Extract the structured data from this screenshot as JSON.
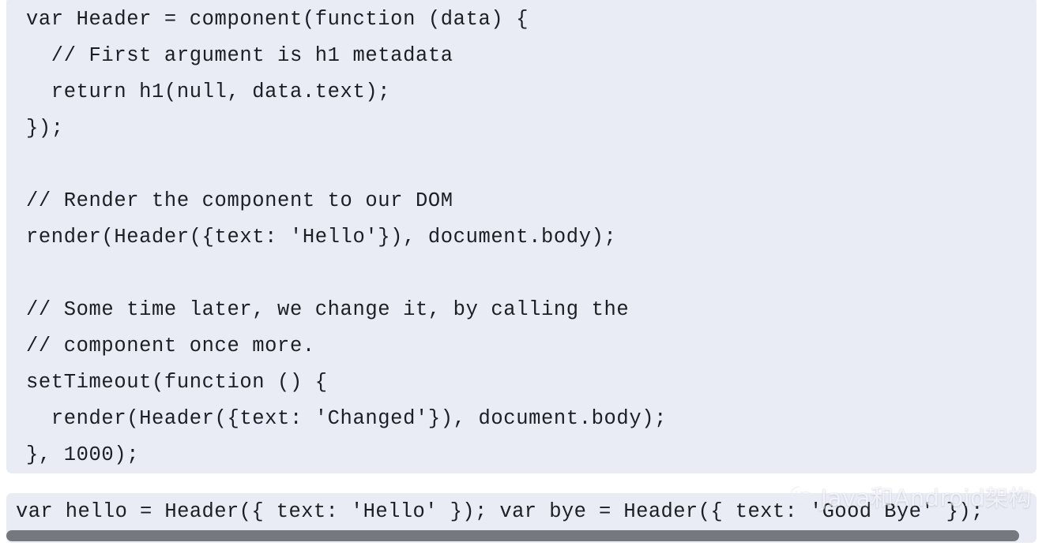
{
  "primary_code_block": {
    "language": "javascript",
    "lines": [
      "var Header = component(function (data) {",
      "  // First argument is h1 metadata",
      "  return h1(null, data.text);",
      "});",
      "",
      "// Render the component to our DOM",
      "render(Header({text: 'Hello'}), document.body);",
      "",
      "// Some time later, we change it, by calling the",
      "// component once more.",
      "setTimeout(function () {",
      "  render(Header({text: 'Changed'}), document.body);",
      "}, 1000);"
    ]
  },
  "secondary_code_block": {
    "language": "javascript",
    "line": "var hello = Header({ text: 'Hello' }); var bye = Header({ text: 'Good Bye' });",
    "scrollbar": {
      "orientation": "horizontal",
      "thumb_color": "#75787f",
      "track_color": "#e9ecf5"
    }
  },
  "watermark": {
    "text": "Java和Android架构",
    "logo": "wechat-bubbles-icon",
    "color": "#f4f5f8"
  },
  "theme": {
    "page_background": "#ffffff",
    "code_background": "#e9ecf5",
    "code_text": "#1c1e24"
  }
}
